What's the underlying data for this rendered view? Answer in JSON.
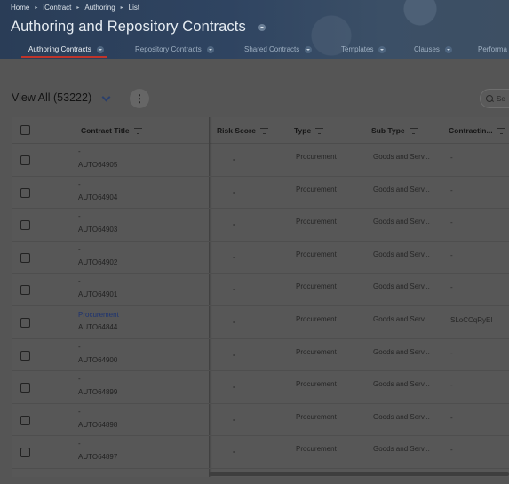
{
  "breadcrumb": [
    "Home",
    "iContract",
    "Authoring",
    "List"
  ],
  "title": "Authoring and Repository Contracts",
  "tabs": [
    {
      "label": "Authoring Contracts",
      "active": true
    },
    {
      "label": "Repository Contracts",
      "active": false
    },
    {
      "label": "Shared Contracts",
      "active": false
    },
    {
      "label": "Templates",
      "active": false
    },
    {
      "label": "Clauses",
      "active": false
    },
    {
      "label": "Performa",
      "active": false
    }
  ],
  "toolbar": {
    "view_label": "View All (53222)",
    "search_placeholder": "Se"
  },
  "columns": [
    "Contract Title",
    "Risk Score",
    "Type",
    "Sub Type",
    "Contractin..."
  ],
  "rows": [
    {
      "title": "-",
      "id": "AUTO64905",
      "risk": "-",
      "type": "Procurement",
      "sub_type": "Goods and Serv...",
      "contracting": "-"
    },
    {
      "title": "-",
      "id": "AUTO64904",
      "risk": "-",
      "type": "Procurement",
      "sub_type": "Goods and Serv...",
      "contracting": "-"
    },
    {
      "title": "-",
      "id": "AUTO64903",
      "risk": "-",
      "type": "Procurement",
      "sub_type": "Goods and Serv...",
      "contracting": "-"
    },
    {
      "title": "-",
      "id": "AUTO64902",
      "risk": "-",
      "type": "Procurement",
      "sub_type": "Goods and Serv...",
      "contracting": "-"
    },
    {
      "title": "-",
      "id": "AUTO64901",
      "risk": "-",
      "type": "Procurement",
      "sub_type": "Goods and Serv...",
      "contracting": "-"
    },
    {
      "title": "Procurement",
      "id": "AUTO64844",
      "risk": "-",
      "type": "Procurement",
      "sub_type": "Goods and Serv...",
      "contracting": "SLoCCqRyEI"
    },
    {
      "title": "-",
      "id": "AUTO64900",
      "risk": "-",
      "type": "Procurement",
      "sub_type": "Goods and Serv...",
      "contracting": "-"
    },
    {
      "title": "-",
      "id": "AUTO64899",
      "risk": "-",
      "type": "Procurement",
      "sub_type": "Goods and Serv...",
      "contracting": "-"
    },
    {
      "title": "-",
      "id": "AUTO64898",
      "risk": "-",
      "type": "Procurement",
      "sub_type": "Goods and Serv...",
      "contracting": "-"
    },
    {
      "title": "-",
      "id": "AUTO64897",
      "risk": "-",
      "type": "Procurement",
      "sub_type": "Goods and Serv...",
      "contracting": "-"
    }
  ]
}
